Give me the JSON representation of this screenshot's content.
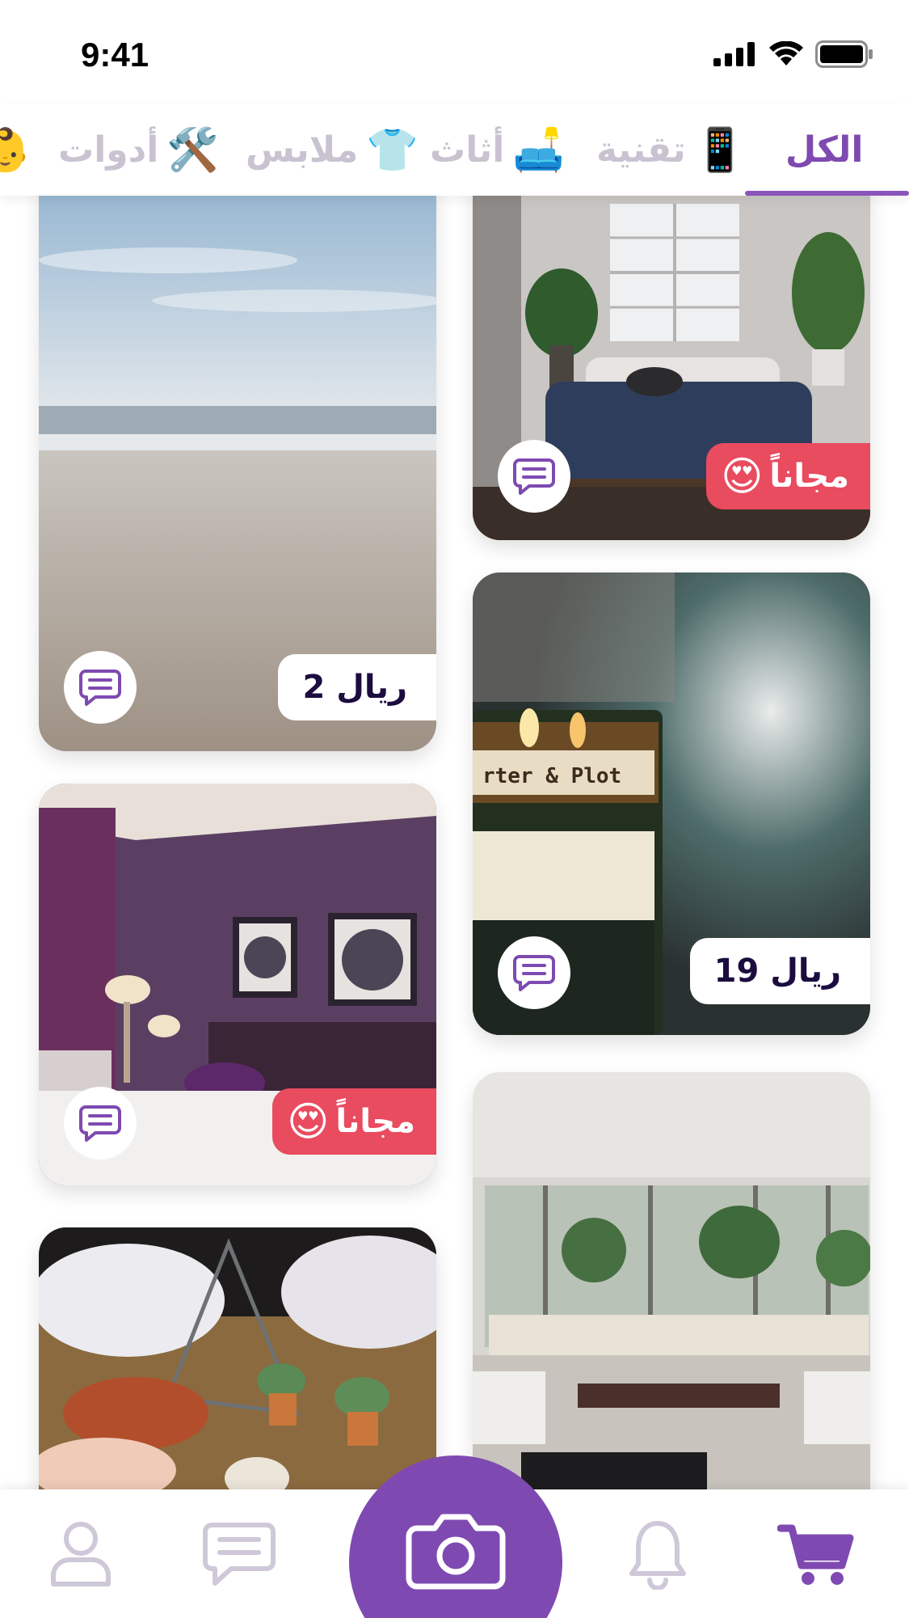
{
  "status_bar": {
    "time": "9:41"
  },
  "tabs": [
    {
      "label": "الكل",
      "emoji": "",
      "active": true
    },
    {
      "label": "تقنية",
      "emoji": "📱",
      "active": false
    },
    {
      "label": "أثاث",
      "emoji": "🛋️",
      "active": false
    },
    {
      "label": "ملابس",
      "emoji": "👕",
      "active": false
    },
    {
      "label": "أدوات",
      "emoji": "🛠️",
      "active": false
    },
    {
      "label": "",
      "emoji": "👶",
      "active": false
    }
  ],
  "listings": [
    {
      "image": "bedroom-with-cat-photo",
      "badge_type": "free",
      "badge_label": "مجاناً",
      "badge_emoji": "😍"
    },
    {
      "image": "beach-photo",
      "badge_type": "price",
      "badge_label": "2 ريال"
    },
    {
      "image": "candle-jar-photo",
      "badge_type": "price",
      "badge_label": "19 ريال"
    },
    {
      "image": "purple-bedroom-photo",
      "badge_type": "free",
      "badge_label": "مجاناً",
      "badge_emoji": "😍"
    },
    {
      "image": "living-room-photo"
    },
    {
      "image": "succulents-terrarium-photo"
    }
  ],
  "bottom_nav": {
    "items": [
      "cart-icon",
      "bell-icon",
      "camera-icon",
      "chat-icon",
      "profile-icon"
    ],
    "active": "cart-icon"
  },
  "colors": {
    "accent": "#7e4ab1",
    "free_badge": "#e94b5f",
    "inactive": "#c9c3d1",
    "price_text": "#1c0c3f"
  }
}
